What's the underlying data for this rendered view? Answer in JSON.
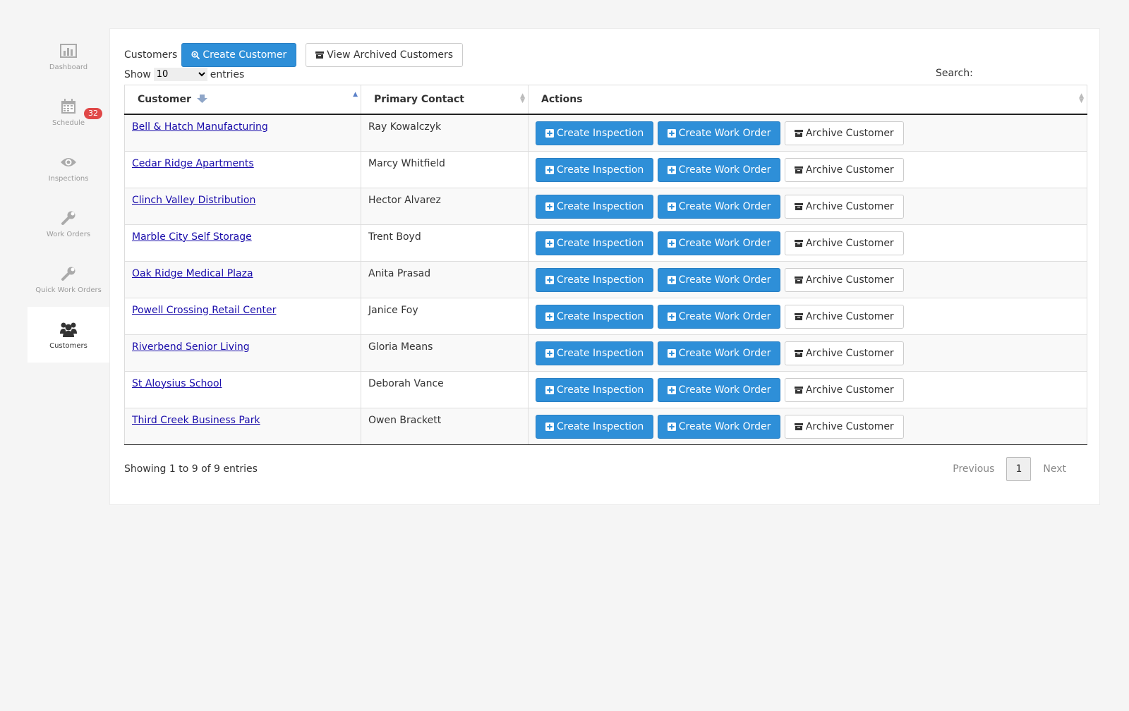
{
  "sidebar": {
    "items": [
      {
        "label": "Dashboard",
        "icon": "bar-chart-icon"
      },
      {
        "label": "Schedule",
        "icon": "calendar-icon",
        "badge": "32"
      },
      {
        "label": "Inspections",
        "icon": "eye-icon"
      },
      {
        "label": "Work Orders",
        "icon": "wrench-icon"
      },
      {
        "label": "Quick Work Orders",
        "icon": "wrench-icon"
      },
      {
        "label": "Customers",
        "icon": "users-icon",
        "active": true
      }
    ]
  },
  "toolbar": {
    "title": "Customers",
    "create_label": "Create Customer",
    "archived_label": "View Archived Customers"
  },
  "length": {
    "show": "Show",
    "value": "10",
    "entries": "entries"
  },
  "search": {
    "label": "Search:"
  },
  "table": {
    "headers": [
      "Customer",
      "Primary Contact",
      "Actions"
    ],
    "action_labels": {
      "inspection": "Create Inspection",
      "work_order": "Create Work Order",
      "archive": "Archive Customer"
    },
    "rows": [
      {
        "customer": "Bell & Hatch Manufacturing",
        "contact": "Ray Kowalczyk"
      },
      {
        "customer": "Cedar Ridge Apartments",
        "contact": "Marcy Whitfield"
      },
      {
        "customer": "Clinch Valley Distribution",
        "contact": "Hector Alvarez"
      },
      {
        "customer": "Marble City Self Storage",
        "contact": "Trent Boyd"
      },
      {
        "customer": "Oak Ridge Medical Plaza",
        "contact": "Anita Prasad"
      },
      {
        "customer": "Powell Crossing Retail Center",
        "contact": "Janice Foy"
      },
      {
        "customer": "Riverbend Senior Living",
        "contact": "Gloria Means"
      },
      {
        "customer": "St Aloysius School",
        "contact": "Deborah Vance"
      },
      {
        "customer": "Third Creek Business Park",
        "contact": "Owen Brackett"
      }
    ]
  },
  "footer": {
    "info": "Showing 1 to 9 of 9 entries",
    "previous": "Previous",
    "page": "1",
    "next": "Next"
  },
  "colors": {
    "primary": "#2e8fd8",
    "badge": "#e04848",
    "link": "#1a0dab"
  }
}
